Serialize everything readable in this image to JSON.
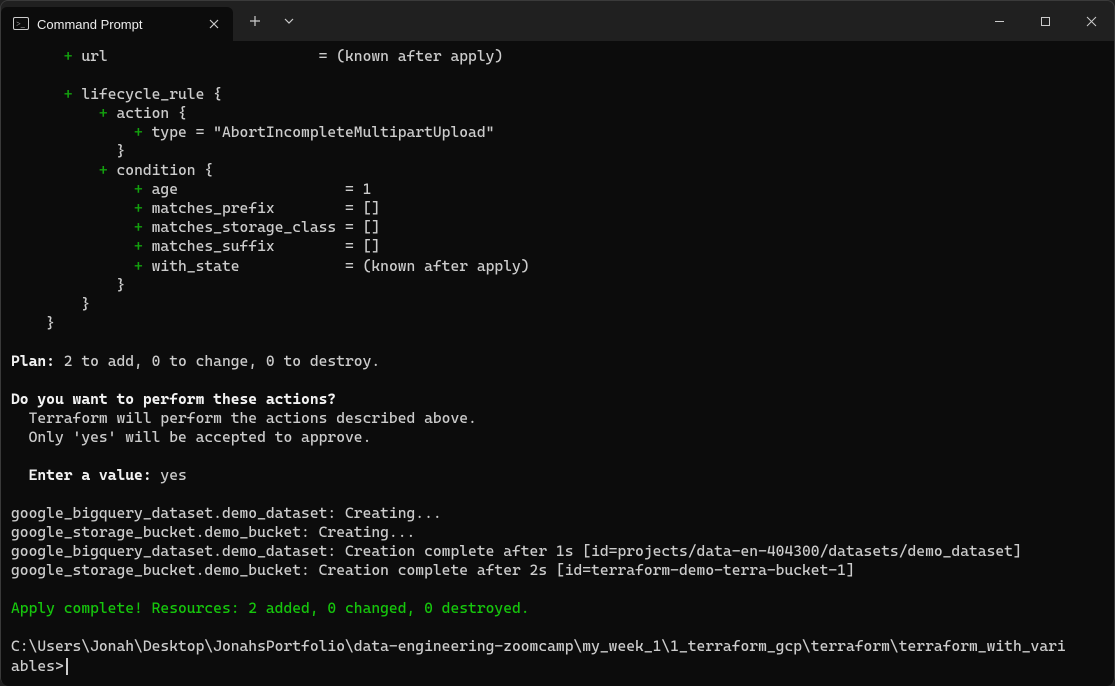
{
  "window": {
    "tab_title": "Command Prompt"
  },
  "terraform": {
    "block": {
      "url_key": "url",
      "url_val": "(known after apply)",
      "lifecycle_rule": "lifecycle_rule {",
      "action": "action {",
      "type_line": "type = \"AbortIncompleteMultipartUpload\"",
      "action_close": "}",
      "condition": "condition {",
      "age_key": "age",
      "age_val": "1",
      "matches_prefix_key": "matches_prefix",
      "matches_prefix_val": "[]",
      "matches_storage_class_key": "matches_storage_class",
      "matches_storage_class_val": "[]",
      "matches_suffix_key": "matches_suffix",
      "matches_suffix_val": "[]",
      "with_state_key": "with_state",
      "with_state_val": "(known after apply)",
      "condition_close": "}",
      "lifecycle_close": "}",
      "resource_close": "}"
    },
    "plan_label": "Plan:",
    "plan_text": " 2 to add, 0 to change, 0 to destroy.",
    "confirm_question": "Do you want to perform these actions?",
    "confirm_line1": "  Terraform will perform the actions described above.",
    "confirm_line2": "  Only 'yes' will be accepted to approve.",
    "enter_value_label": "Enter a value:",
    "enter_value_input": "yes",
    "progress": {
      "l1": "google_bigquery_dataset.demo_dataset: Creating...",
      "l2": "google_storage_bucket.demo_bucket: Creating...",
      "l3": "google_bigquery_dataset.demo_dataset: Creation complete after 1s [id=projects/data-en-404300/datasets/demo_dataset]",
      "l4": "google_storage_bucket.demo_bucket: Creation complete after 2s [id=terraform-demo-terra-bucket-1]"
    },
    "apply_complete": "Apply complete! Resources: 2 added, 0 changed, 0 destroyed.",
    "prompt_line1": "C:\\Users\\Jonah\\Desktop\\JonahsPortfolio\\data-engineering-zoomcamp\\my_week_1\\1_terraform_gcp\\terraform\\terraform_with_vari",
    "prompt_line2": "ables>"
  }
}
